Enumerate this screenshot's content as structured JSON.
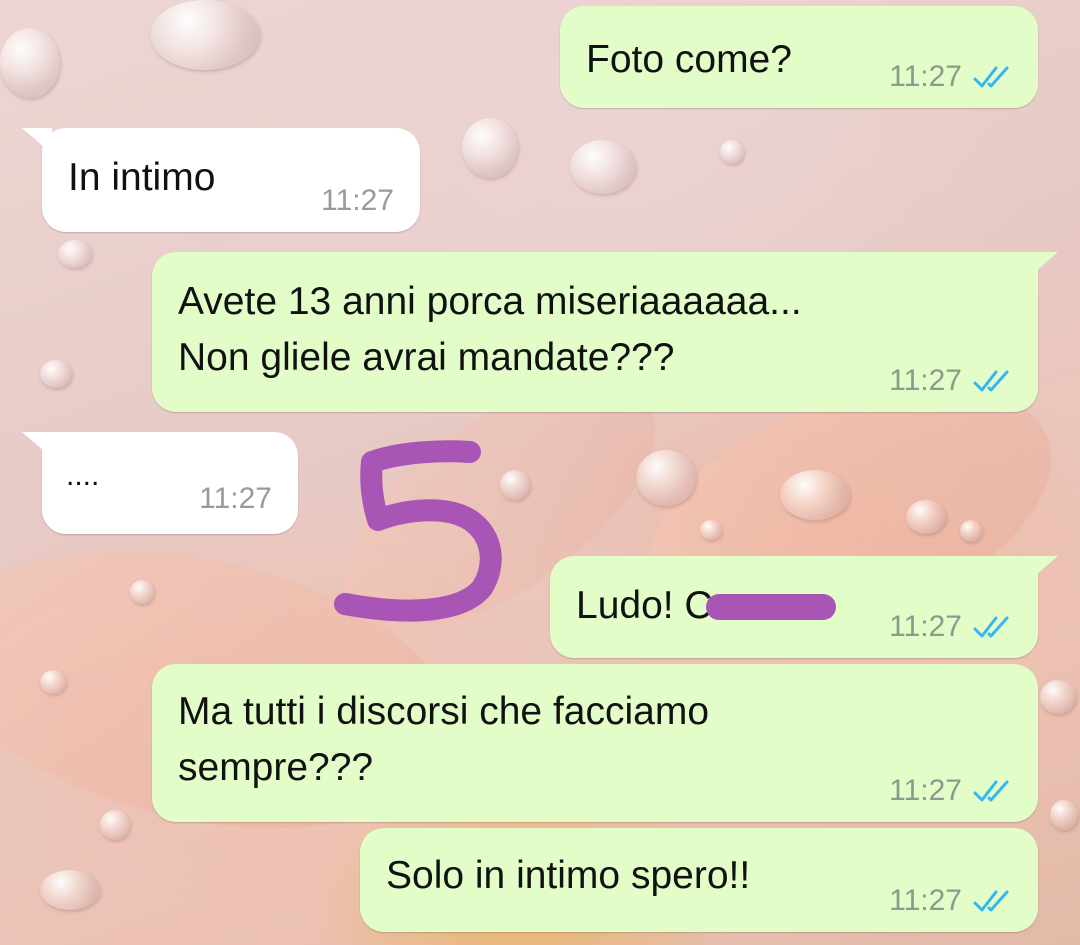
{
  "chat": {
    "messages": [
      {
        "direction": "out",
        "text": "Foto come?",
        "time": "11:27",
        "status": "read"
      },
      {
        "direction": "in",
        "text": "In intimo",
        "time": "11:27"
      },
      {
        "direction": "out",
        "text": "Avete 13 anni porca miseriaaaaaa...\nNon gliele avrai mandate???",
        "time": "11:27",
        "status": "read"
      },
      {
        "direction": "in",
        "text": "....",
        "time": "11:27"
      },
      {
        "direction": "out",
        "text": "Ludo! C",
        "time": "11:27",
        "status": "read"
      },
      {
        "direction": "out",
        "text": "Ma tutti i discorsi che facciamo\nsempre???",
        "time": "11:27",
        "status": "read"
      },
      {
        "direction": "out",
        "text": "Solo in intimo spero!!",
        "time": "11:27",
        "status": "read"
      }
    ]
  },
  "annotation": {
    "number": "5",
    "color": "#a855b5"
  },
  "colors": {
    "outgoing_bubble": "#e2fdc8",
    "incoming_bubble": "#ffffff",
    "read_ticks": "#34b7f1",
    "time_text": "#8c9a8e"
  }
}
